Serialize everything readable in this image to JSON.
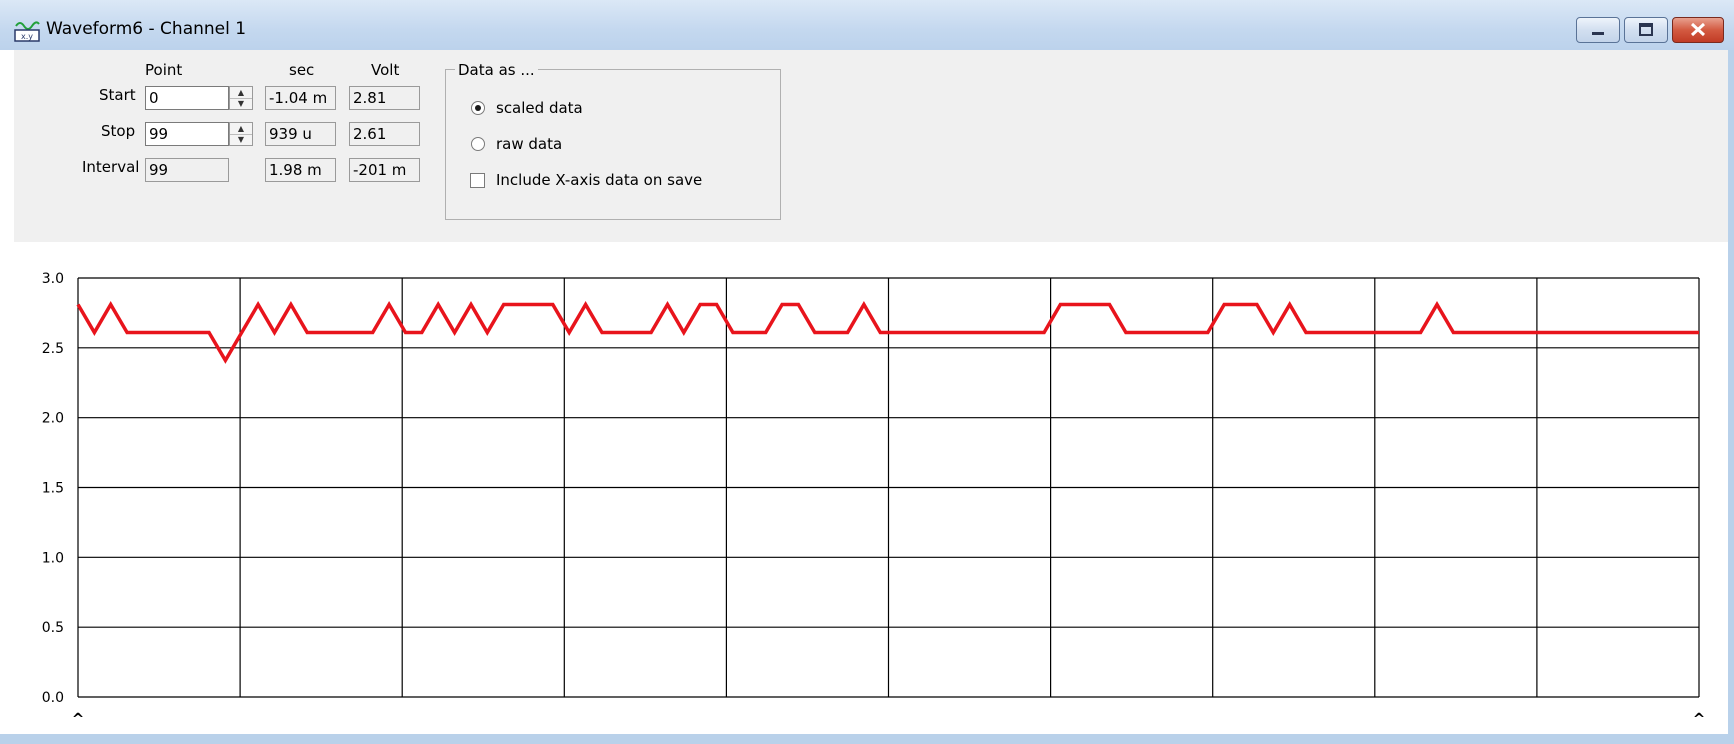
{
  "window": {
    "title": "Waveform6 - Channel 1",
    "minimize_icon": "minimize-icon",
    "maximize_icon": "maximize-icon",
    "close_icon": "close-icon"
  },
  "controls": {
    "col_point": "Point",
    "col_sec": "sec",
    "col_volt": "Volt",
    "start": {
      "label": "Start",
      "point": "0",
      "sec": "-1.04 m",
      "volt": "2.81"
    },
    "stop": {
      "label": "Stop",
      "point": "99",
      "sec": "939 u",
      "volt": "2.61"
    },
    "interval": {
      "label": "Interval",
      "point": "99",
      "sec": "1.98 m",
      "volt": "-201 m"
    }
  },
  "data_as": {
    "title": "Data as ...",
    "scaled_label": "scaled data",
    "raw_label": "raw data",
    "include_x_label": "Include X-axis data on save",
    "selected": "scaled data",
    "include_x_checked": false
  },
  "chart_data": {
    "type": "line",
    "y_ticks": [
      "3.0",
      "2.5",
      "2.0",
      "1.5",
      "1.0",
      "0.5",
      "0.0"
    ],
    "ylim": [
      0,
      3.0
    ],
    "xlim": [
      0,
      99
    ],
    "grid": true,
    "cursor_marker": "^",
    "series": [
      {
        "color": "#e8141c",
        "values": [
          2.81,
          2.61,
          2.81,
          2.61,
          2.61,
          2.61,
          2.61,
          2.61,
          2.61,
          2.41,
          2.61,
          2.81,
          2.61,
          2.81,
          2.61,
          2.61,
          2.61,
          2.61,
          2.61,
          2.81,
          2.61,
          2.61,
          2.81,
          2.61,
          2.81,
          2.61,
          2.81,
          2.81,
          2.81,
          2.81,
          2.61,
          2.81,
          2.61,
          2.61,
          2.61,
          2.61,
          2.81,
          2.61,
          2.81,
          2.81,
          2.61,
          2.61,
          2.61,
          2.81,
          2.81,
          2.61,
          2.61,
          2.61,
          2.81,
          2.61,
          2.61,
          2.61,
          2.61,
          2.61,
          2.61,
          2.61,
          2.61,
          2.61,
          2.61,
          2.61,
          2.81,
          2.81,
          2.81,
          2.81,
          2.61,
          2.61,
          2.61,
          2.61,
          2.61,
          2.61,
          2.81,
          2.81,
          2.81,
          2.61,
          2.81,
          2.61,
          2.61,
          2.61,
          2.61,
          2.61,
          2.61,
          2.61,
          2.61,
          2.81,
          2.61,
          2.61,
          2.61,
          2.61,
          2.61,
          2.61,
          2.61,
          2.61,
          2.61,
          2.61,
          2.61,
          2.61,
          2.61,
          2.61,
          2.61,
          2.61
        ]
      }
    ]
  }
}
